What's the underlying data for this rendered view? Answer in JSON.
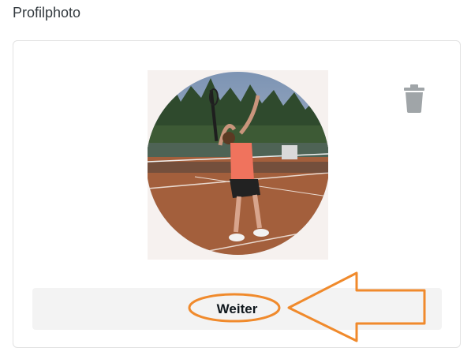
{
  "section": {
    "title": "Profilphoto"
  },
  "photo": {
    "alt": "Profilphoto"
  },
  "actions": {
    "continue_label": "Weiter"
  },
  "icons": {
    "delete": "trash-icon"
  },
  "colors": {
    "annotation": "#f08a2c",
    "button_bg": "#f3f3f3",
    "icon_gray": "#a0a5a8"
  }
}
